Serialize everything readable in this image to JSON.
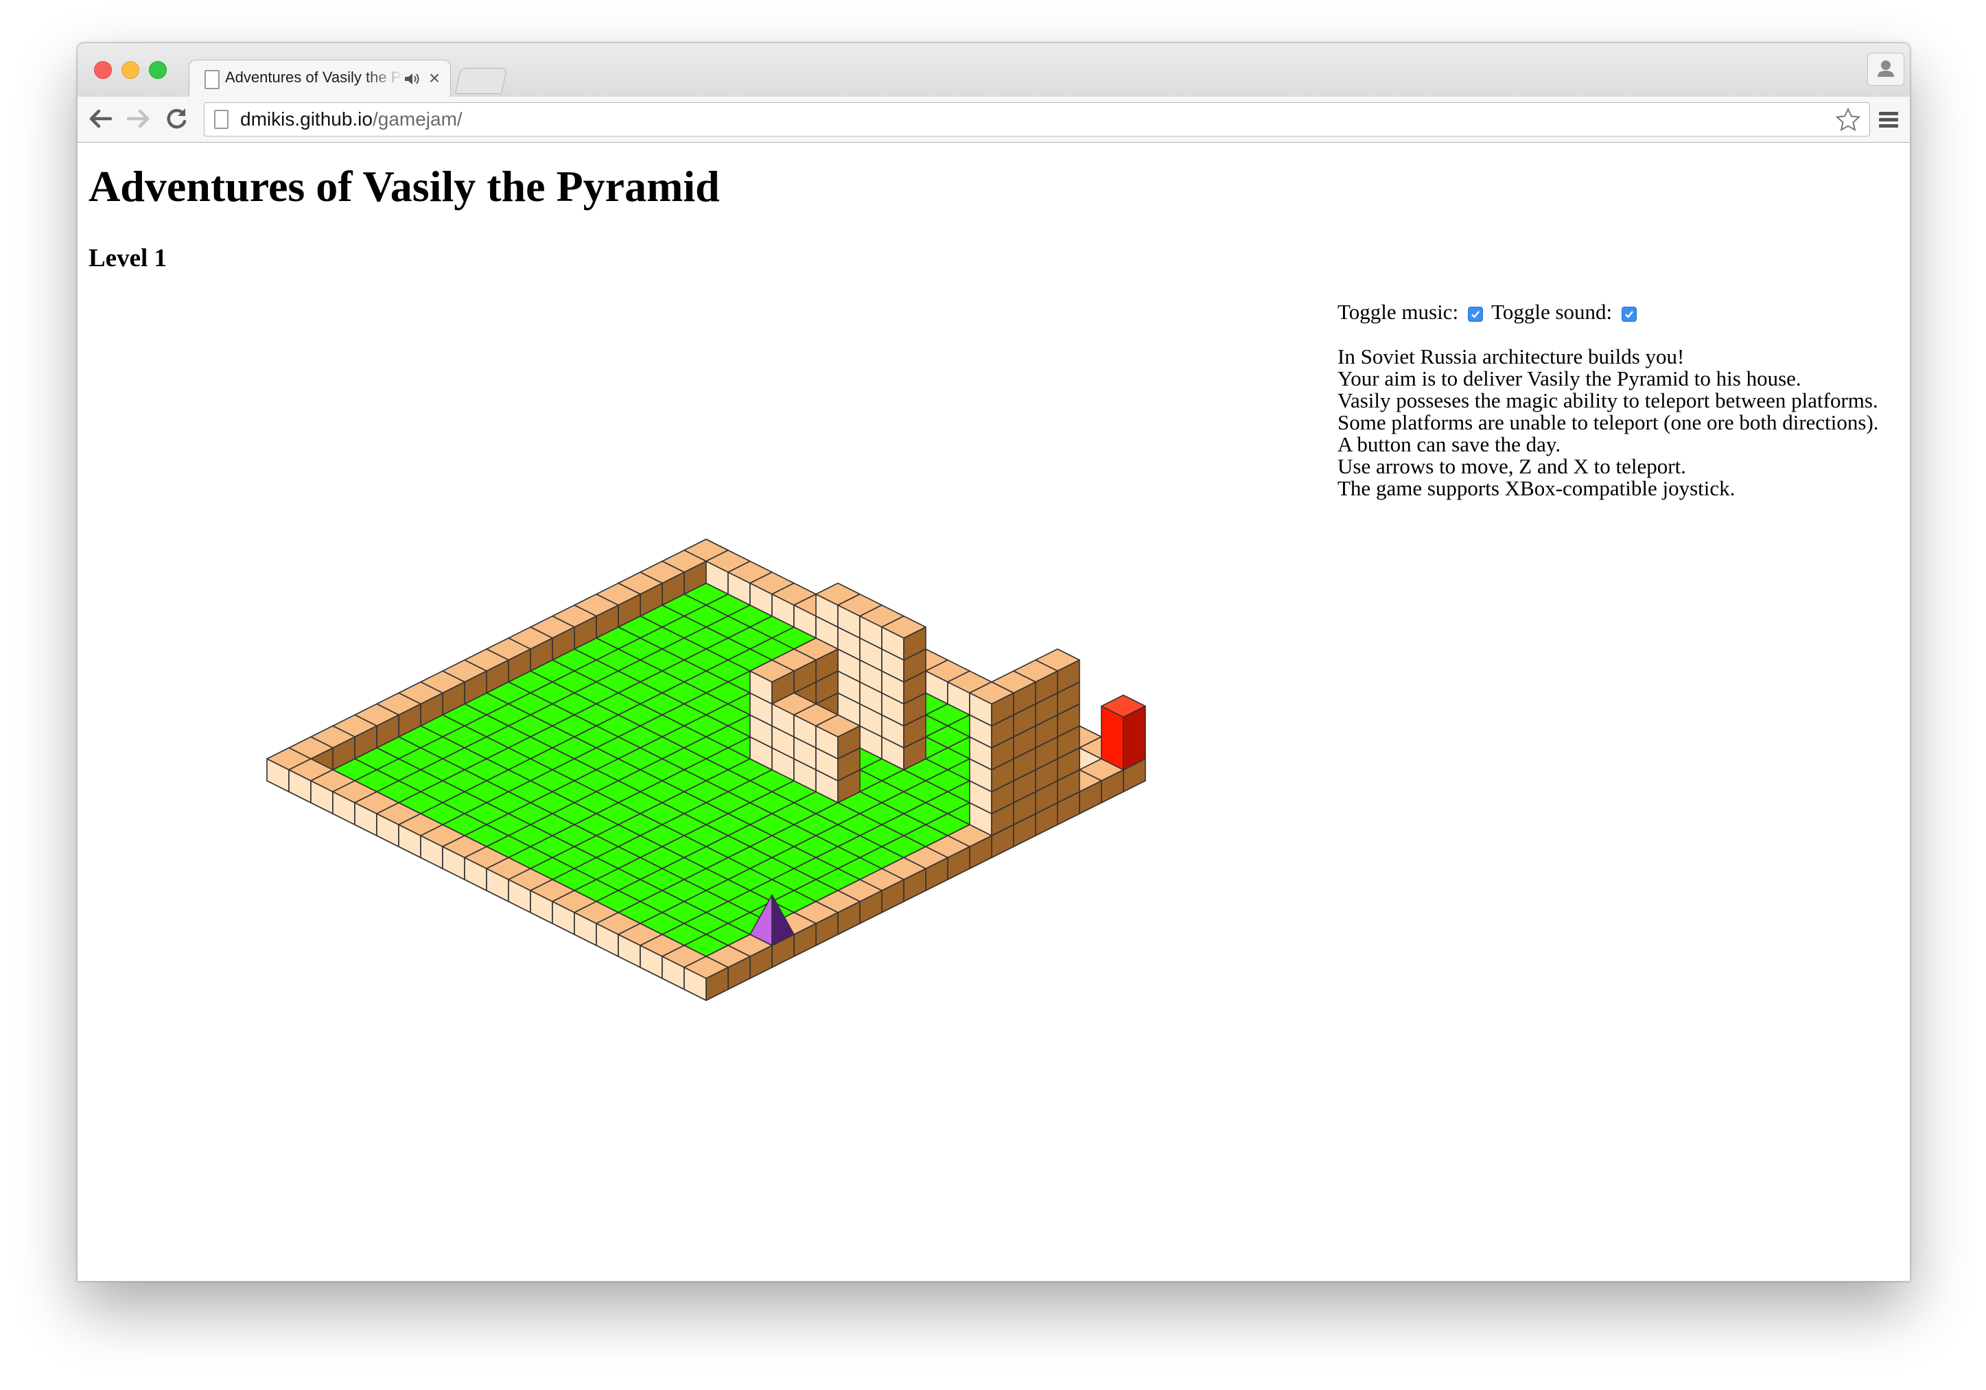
{
  "browser": {
    "tab_title": "Adventures of Vasily the Pyramid",
    "url_host": "dmikis.github.io",
    "url_path": "/gamejam/"
  },
  "page": {
    "title": "Adventures of Vasily the Pyramid",
    "level": "Level 1"
  },
  "controls": {
    "music_label": "Toggle music:",
    "music_checked": true,
    "sound_label": "Toggle sound:",
    "sound_checked": true
  },
  "instructions": [
    "In Soviet Russia architecture builds you!",
    "Your aim is to deliver Vasily the Pyramid to his house.",
    "Vasily posseses the magic ability to teleport between platforms.",
    "Some platforms are unable to teleport (one ore both directions).",
    "A button can save the day.",
    "Use arrows to move, Z and X to teleport.",
    "The game supports XBox-compatible joystick."
  ],
  "colors": {
    "grass": "#33ff00",
    "block_top": "#f9be86",
    "block_left": "#ffe4c4",
    "block_right": "#9c6428",
    "house": "#ff1a00",
    "pyramid_light": "#c465e6",
    "pyramid_dark": "#4c1f6e",
    "checkbox": "#3b8ef2"
  }
}
